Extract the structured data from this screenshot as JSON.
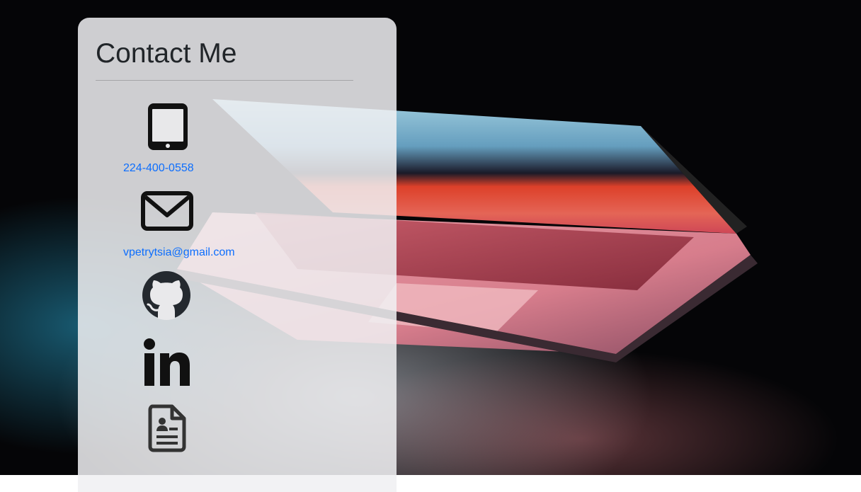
{
  "page": {
    "title": "Contact Me"
  },
  "contacts": {
    "phone": {
      "icon": "tablet-phone-icon",
      "label": "224-400-0558"
    },
    "email": {
      "icon": "envelope-icon",
      "label": "vpetrytsia@gmail.com"
    },
    "github": {
      "icon": "github-icon"
    },
    "linkedin": {
      "icon": "linkedin-icon"
    },
    "resume": {
      "icon": "resume-document-icon"
    }
  },
  "colors": {
    "link": "#0d6efd",
    "heading": "#212529",
    "panel_bg": "rgba(240,240,242,0.86)"
  }
}
